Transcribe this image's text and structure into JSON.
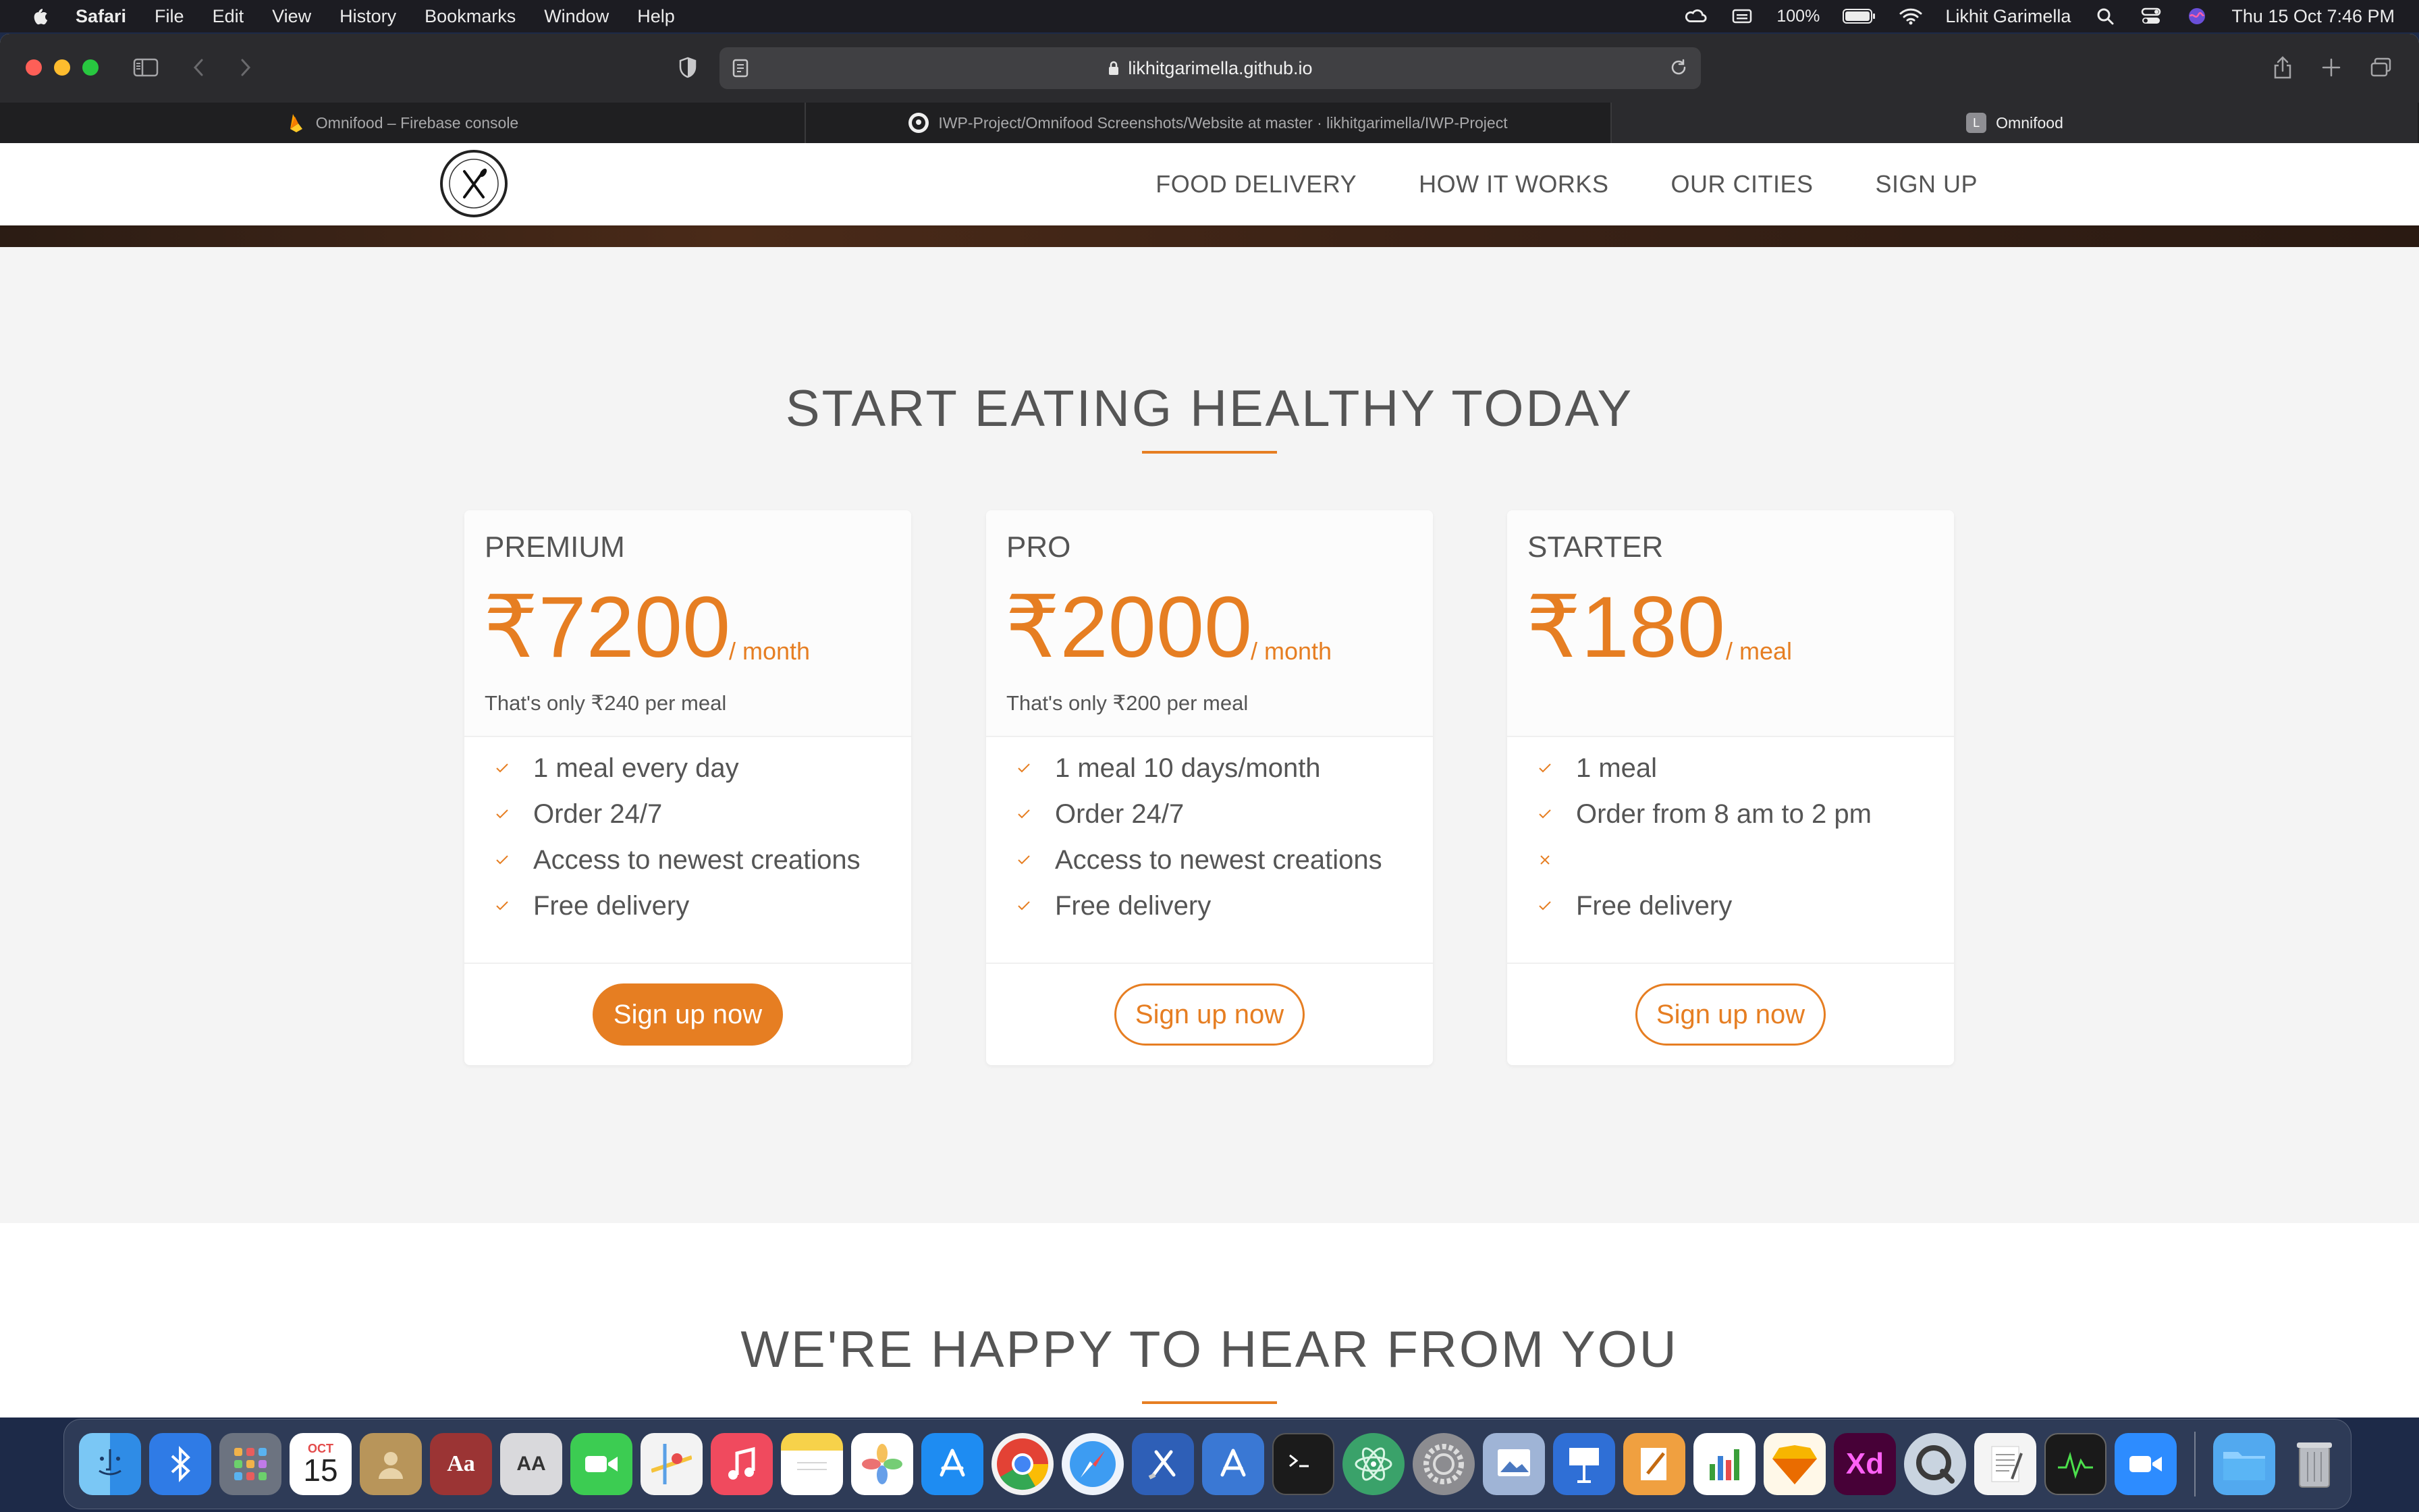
{
  "menubar": {
    "app": "Safari",
    "items": [
      "File",
      "Edit",
      "View",
      "History",
      "Bookmarks",
      "Window",
      "Help"
    ],
    "battery": "100%",
    "user": "Likhit Garimella",
    "datetime": "Thu 15 Oct  7:46 PM"
  },
  "browser": {
    "url": "likhitgarimella.github.io",
    "tabs": [
      {
        "title": "Omnifood – Firebase console"
      },
      {
        "title": "IWP-Project/Omnifood Screenshots/Website at master · likhitgarimella/IWP-Project"
      },
      {
        "title": "Omnifood",
        "favicon_letter": "L"
      }
    ]
  },
  "site": {
    "nav": [
      "FOOD DELIVERY",
      "HOW IT WORKS",
      "OUR CITIES",
      "SIGN UP"
    ],
    "plans_title": "START EATING HEALTHY TODAY",
    "plans": [
      {
        "name": "PREMIUM",
        "price": "₹7200",
        "unit": "/ month",
        "note": "That's only ₹240 per meal",
        "features": [
          "1 meal every day",
          "Order 24/7",
          "Access to newest creations",
          "Free delivery"
        ],
        "button": "Sign up now"
      },
      {
        "name": "PRO",
        "price": "₹2000",
        "unit": "/ month",
        "note": "That's only ₹200 per meal",
        "features": [
          "1 meal 10 days/month",
          "Order 24/7",
          "Access to newest creations",
          "Free delivery"
        ],
        "button": "Sign up now"
      },
      {
        "name": "STARTER",
        "price": "₹180",
        "unit": "/ meal",
        "note": "",
        "features": [
          "1 meal",
          "Order from 8 am to 2 pm",
          "",
          "Free delivery"
        ],
        "button": "Sign up now"
      }
    ],
    "contact_title": "WE'RE HAPPY TO HEAR FROM YOU"
  },
  "dock": {
    "calendar_month": "OCT",
    "calendar_day": "15",
    "dictionary_glyph": "Aa",
    "fontbook_glyph": "AA",
    "xd_label": "Xd"
  },
  "colors": {
    "accent": "#e67e22",
    "text": "#555555"
  }
}
